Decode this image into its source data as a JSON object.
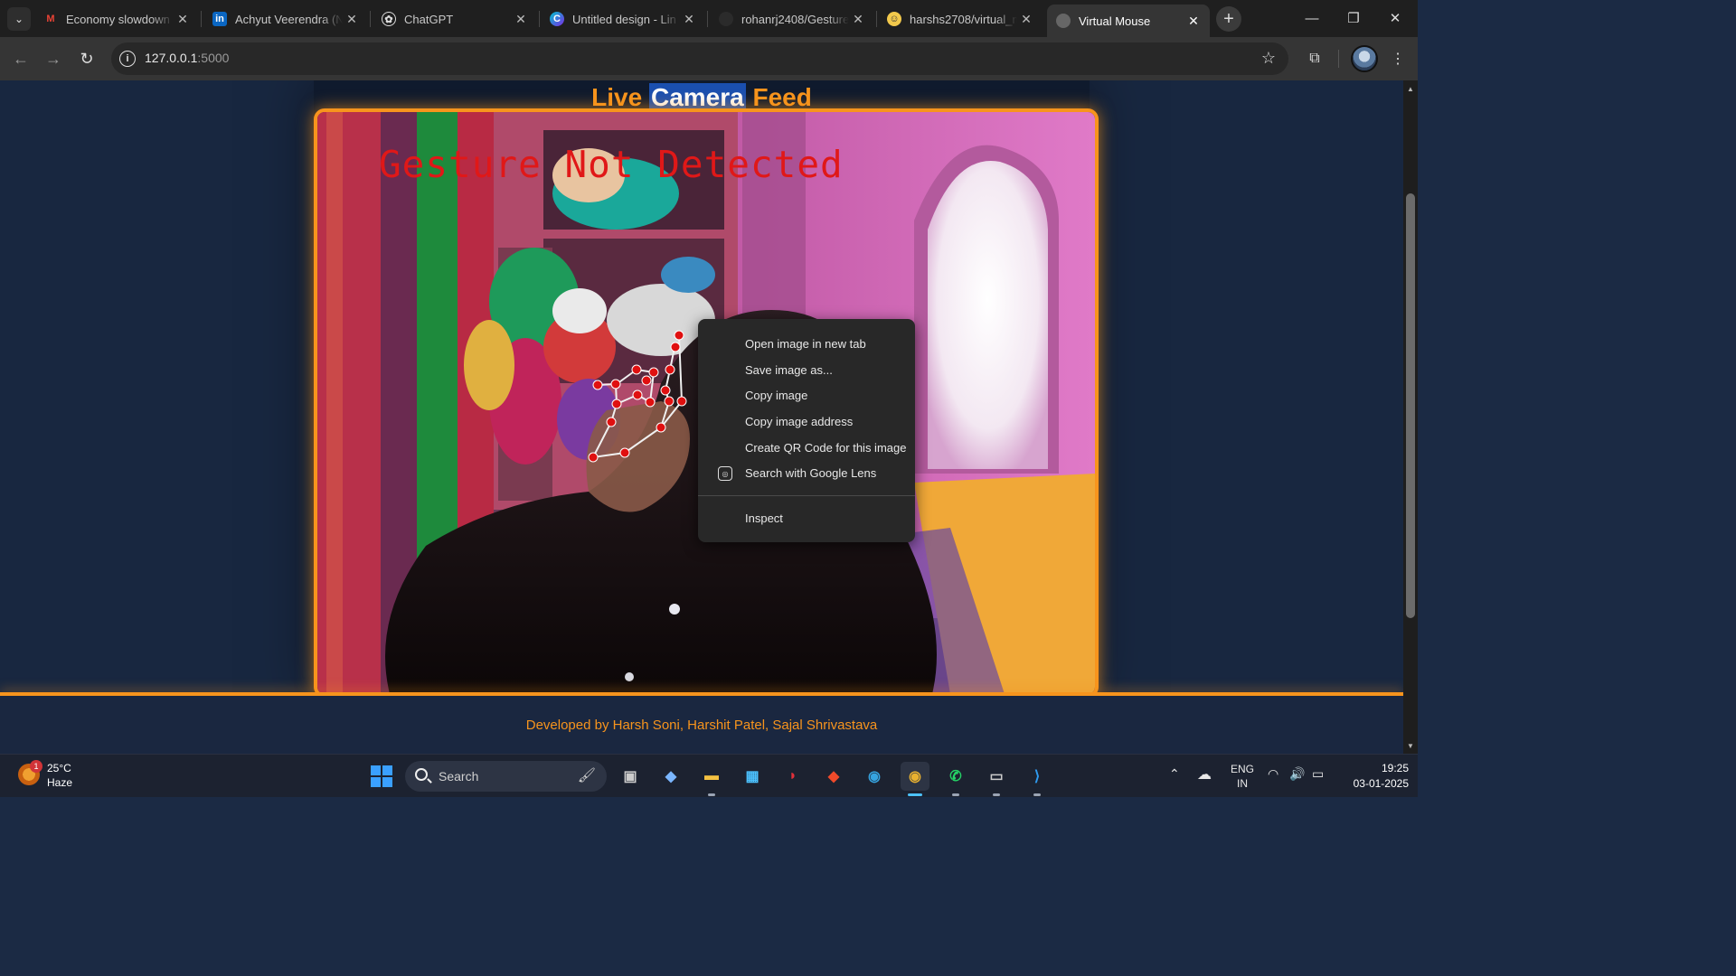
{
  "browser": {
    "tabs": [
      {
        "title": "Economy slowdown s",
        "favicon": "gmail-icon",
        "color": "#d93025"
      },
      {
        "title": "Achyut Veerendra (N",
        "favicon": "linkedin-icon",
        "color": "#0a66c2"
      },
      {
        "title": "ChatGPT",
        "favicon": "chatgpt-icon",
        "color": "#ffffff"
      },
      {
        "title": "Untitled design - Lin",
        "favicon": "canva-icon",
        "color": "#00c4cc"
      },
      {
        "title": "rohanrj2408/Gesture",
        "favicon": "github-icon",
        "color": "#2b2b2b"
      },
      {
        "title": "harshs2708/virtual_m",
        "favicon": "github-copilot-icon",
        "color": "#f2c94c"
      },
      {
        "title": "Virtual Mouse",
        "favicon": "globe-icon",
        "color": "#888888",
        "active": true
      }
    ],
    "url_host": "127.0.0.1",
    "url_port": ":5000"
  },
  "page": {
    "heading_pre": "Live ",
    "heading_sel": "Camera",
    "heading_post": " Feed",
    "overlay_text": "Gesture Not Detected",
    "footer": "Developed by Harsh Soni, Harshit Patel, Sajal Shrivastava",
    "accent": "#f7941d"
  },
  "context_menu": {
    "items": [
      "Open image in new tab",
      "Save image as...",
      "Copy image",
      "Copy image address",
      "Create QR Code for this image",
      "Search with Google Lens"
    ],
    "inspect": "Inspect"
  },
  "taskbar": {
    "weather_temp": "25°C",
    "weather_desc": "Haze",
    "weather_badge": "1",
    "search_label": "Search",
    "lang1": "ENG",
    "lang2": "IN",
    "time": "19:25",
    "date": "03-01-2025"
  }
}
